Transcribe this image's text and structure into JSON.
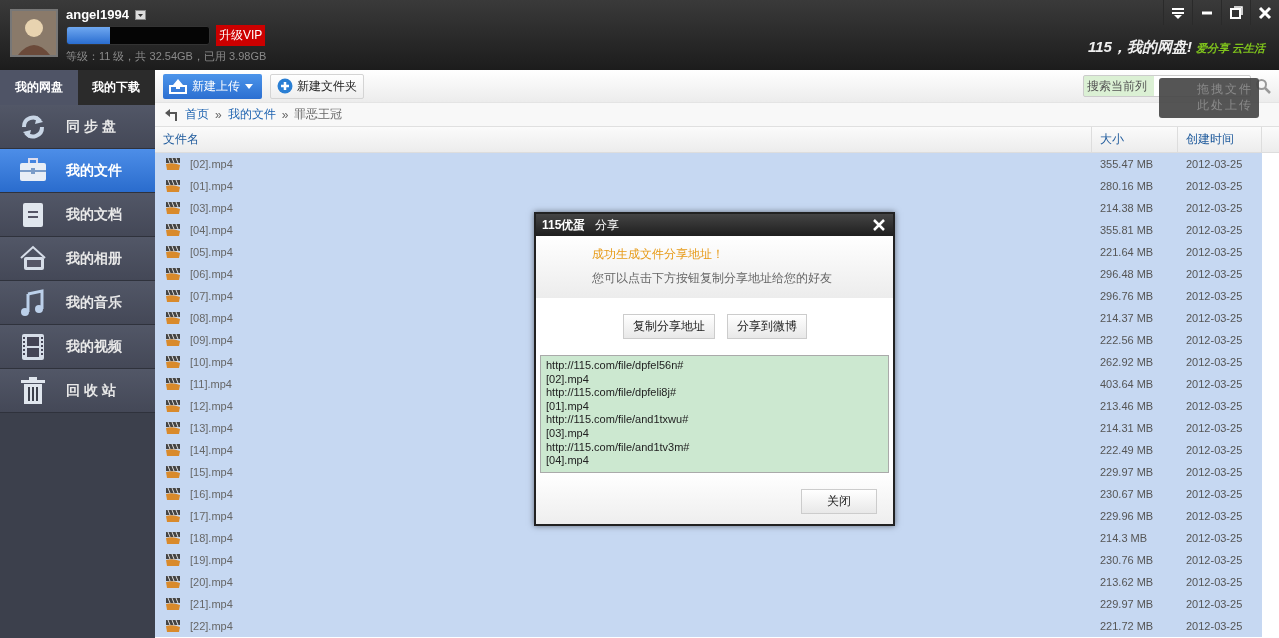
{
  "header": {
    "username": "angel1994",
    "storage": {
      "level": 0.3
    },
    "vip_button": "升级VIP",
    "quota": "等级：11 级，共 32.54GB，已用 3.98GB",
    "slogan": "115，我的网盘!",
    "tagline": "爱分享 云生活"
  },
  "window_controls": [
    {
      "kind": "menu"
    },
    {
      "kind": "minimize"
    },
    {
      "kind": "maximize"
    },
    {
      "kind": "close"
    }
  ],
  "sidebar": {
    "tabs": [
      {
        "label": "我的网盘",
        "selected": true
      },
      {
        "label": "我的下载",
        "selected": false
      }
    ],
    "items": [
      {
        "label": "同 步 盘",
        "kind": "sync",
        "selected": false
      },
      {
        "label": "我的文件",
        "kind": "files",
        "selected": true
      },
      {
        "label": "我的文档",
        "kind": "docs",
        "selected": false
      },
      {
        "label": "我的相册",
        "kind": "photos",
        "selected": false
      },
      {
        "label": "我的音乐",
        "kind": "music",
        "selected": false
      },
      {
        "label": "我的视频",
        "kind": "video",
        "selected": false
      },
      {
        "label": "回 收 站",
        "kind": "trash",
        "selected": false
      }
    ]
  },
  "toolbar": {
    "upload_button": "新建上传",
    "new_folder_button": "新建文件夹",
    "search": {
      "placeholder": "搜索当前列"
    },
    "drop_zone": [
      "拖拽文件",
      "此处上传"
    ]
  },
  "breadcrumb": [
    {
      "text": "首页",
      "kind": "link"
    },
    {
      "text": "»",
      "kind": "separator"
    },
    {
      "text": "我的文件",
      "kind": "link"
    },
    {
      "text": "»",
      "kind": "separator"
    },
    {
      "text": "罪恶王冠",
      "kind": "current"
    }
  ],
  "table": {
    "columns": [
      "文件名",
      "大小",
      "创建时间"
    ],
    "rows": [
      {
        "name": "[02].mp4",
        "size": "355.47 MB",
        "date": "2012-03-25",
        "selected": true
      },
      {
        "name": "[01].mp4",
        "size": "280.16 MB",
        "date": "2012-03-25",
        "selected": true
      },
      {
        "name": "[03].mp4",
        "size": "214.38 MB",
        "date": "2012-03-25",
        "selected": true
      },
      {
        "name": "[04].mp4",
        "size": "355.81 MB",
        "date": "2012-03-25",
        "selected": true
      },
      {
        "name": "[05].mp4",
        "size": "221.64 MB",
        "date": "2012-03-25",
        "selected": true
      },
      {
        "name": "[06].mp4",
        "size": "296.48 MB",
        "date": "2012-03-25",
        "selected": true
      },
      {
        "name": "[07].mp4",
        "size": "296.76 MB",
        "date": "2012-03-25",
        "selected": true
      },
      {
        "name": "[08].mp4",
        "size": "214.37 MB",
        "date": "2012-03-25",
        "selected": true
      },
      {
        "name": "[09].mp4",
        "size": "222.56 MB",
        "date": "2012-03-25",
        "selected": true
      },
      {
        "name": "[10].mp4",
        "size": "262.92 MB",
        "date": "2012-03-25",
        "selected": true
      },
      {
        "name": "[11].mp4",
        "size": "403.64 MB",
        "date": "2012-03-25",
        "selected": true
      },
      {
        "name": "[12].mp4",
        "size": "213.46 MB",
        "date": "2012-03-25",
        "selected": true
      },
      {
        "name": "[13].mp4",
        "size": "214.31 MB",
        "date": "2012-03-25",
        "selected": true
      },
      {
        "name": "[14].mp4",
        "size": "222.49 MB",
        "date": "2012-03-25",
        "selected": true
      },
      {
        "name": "[15].mp4",
        "size": "229.97 MB",
        "date": "2012-03-25",
        "selected": true
      },
      {
        "name": "[16].mp4",
        "size": "230.67 MB",
        "date": "2012-03-25",
        "selected": true
      },
      {
        "name": "[17].mp4",
        "size": "229.96 MB",
        "date": "2012-03-25",
        "selected": true
      },
      {
        "name": "[18].mp4",
        "size": "214.3 MB",
        "date": "2012-03-25",
        "selected": true
      },
      {
        "name": "[19].mp4",
        "size": "230.76 MB",
        "date": "2012-03-25",
        "selected": true
      },
      {
        "name": "[20].mp4",
        "size": "213.62 MB",
        "date": "2012-03-25",
        "selected": true
      },
      {
        "name": "[21].mp4",
        "size": "229.97 MB",
        "date": "2012-03-25",
        "selected": true
      },
      {
        "name": "[22].mp4",
        "size": "221.72 MB",
        "date": "2012-03-25",
        "selected": true
      }
    ]
  },
  "dialog": {
    "brand": "115优蛋",
    "title": "分享",
    "success": "成功生成文件分享地址！",
    "hint": "您可以点击下方按钮复制分享地址给您的好友",
    "buttons": [
      "复制分享地址",
      "分享到微博"
    ],
    "share_text": [
      "http://115.com/file/dpfel56n#",
      "[02].mp4",
      "http://115.com/file/dpfeli8j#",
      "[01].mp4",
      "http://115.com/file/and1txwu#",
      "[03].mp4",
      "http://115.com/file/and1tv3m#",
      "[04].mp4"
    ],
    "close_button": "关闭"
  }
}
